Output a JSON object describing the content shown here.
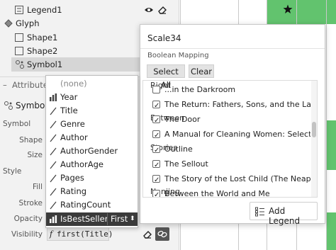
{
  "sidebar": {
    "tree": [
      {
        "label": "Legend1",
        "icon": "legend-icon"
      },
      {
        "label": "Glyph",
        "icon": "glyph-icon"
      },
      {
        "label": "Shape1",
        "icon": "shape-icon"
      },
      {
        "label": "Shape2",
        "icon": "shape-icon"
      },
      {
        "label": "Symbol1",
        "icon": "symbol-icon",
        "selected": true
      }
    ],
    "attributes_header": "Attributes",
    "symbol_name": "Symbol1",
    "properties": {
      "symbol": "Symbol",
      "shape": "Shape",
      "size": "Size",
      "style": "Style",
      "fill": "Fill",
      "stroke": "Stroke",
      "opacity": "Opacity",
      "visibility": "Visibility"
    },
    "visibility_expr": "first(Title)",
    "expr_prefix": "f"
  },
  "field_menu": {
    "none_label": "(none)",
    "items": [
      "Year",
      "Title",
      "Genre",
      "Author",
      "AuthorGender",
      "AuthorAge",
      "Pages",
      "Rating",
      "RatingCount",
      "IsBestSeller"
    ],
    "active_item": "IsBestSeller",
    "aggregation": "First"
  },
  "scale_popover": {
    "title": "Scale34",
    "mapping_label": "Boolean Mapping",
    "select_all": "Select All",
    "clear": "Clear",
    "groups": [
      "Right",
      "Between",
      "Stories",
      "Nanjing"
    ],
    "values": [
      "...in the Darkroom",
      "The Return: Fathers, Sons, and the Land in",
      "The Door",
      "A Manual for Cleaning Women: Selected",
      "Outline",
      "The Sellout",
      "The Story of the Lost Child (The Neapolitan",
      "Between the World and Me"
    ],
    "add_legend": "Add Legend"
  },
  "colors": {
    "accent_green": "#62c36e",
    "menu_active": "#3b3b3b"
  }
}
